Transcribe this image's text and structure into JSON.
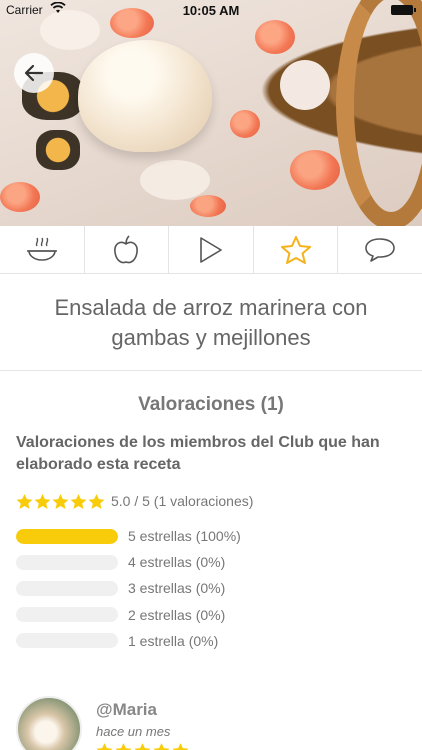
{
  "status_bar": {
    "carrier": "Carrier",
    "time": "10:05 AM"
  },
  "tabs": [
    {
      "id": "cooking",
      "icon": "cooking-pot-icon",
      "active": false
    },
    {
      "id": "nutrition",
      "icon": "apple-icon",
      "active": false
    },
    {
      "id": "video",
      "icon": "play-icon",
      "active": false
    },
    {
      "id": "ratings",
      "icon": "star-icon",
      "active": true
    },
    {
      "id": "comments",
      "icon": "speech-bubble-icon",
      "active": false
    }
  ],
  "recipe": {
    "title": "Ensalada de arroz marinera con gambas y mejillones"
  },
  "ratings": {
    "heading": "Valoraciones (1)",
    "subheading": "Valoraciones de los miembros del Club que han elaborado esta receta",
    "average_stars": 5,
    "summary": "5.0 / 5 (1 valoraciones)",
    "distribution": [
      {
        "label": "5 estrellas (100%)",
        "fraction": 1.0
      },
      {
        "label": "4 estrellas (0%)",
        "fraction": 0
      },
      {
        "label": "3 estrellas (0%)",
        "fraction": 0
      },
      {
        "label": "2 estrellas (0%)",
        "fraction": 0
      },
      {
        "label": "1 estrella (0%)",
        "fraction": 0
      }
    ]
  },
  "reviews": [
    {
      "user": "@Maria",
      "when": "hace un mes",
      "stars": 5
    }
  ],
  "colors": {
    "accent": "#f8cc0a",
    "star_tab": "#f5b21b",
    "icon": "#555555"
  }
}
